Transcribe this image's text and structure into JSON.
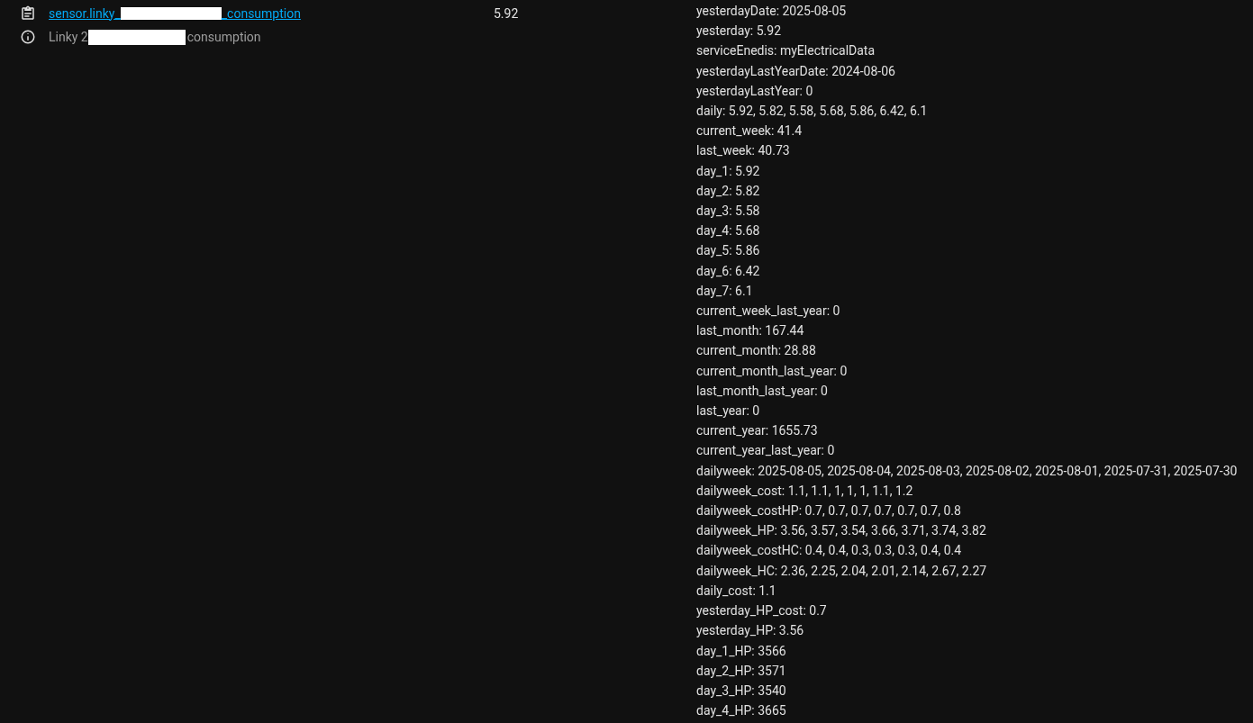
{
  "entity": {
    "entity_id_start": "sensor.linky_",
    "entity_id_end": "_consumption",
    "name_start": "Linky 2",
    "name_end": "consumption",
    "state": "5.92"
  },
  "attributes": [
    "yesterdayDate: 2025-08-05",
    "yesterday: 5.92",
    "serviceEnedis: myElectricalData",
    "yesterdayLastYearDate: 2024-08-06",
    "yesterdayLastYear: 0",
    "daily: 5.92, 5.82, 5.58, 5.68, 5.86, 6.42, 6.1",
    "current_week: 41.4",
    "last_week: 40.73",
    "day_1: 5.92",
    "day_2: 5.82",
    "day_3: 5.58",
    "day_4: 5.68",
    "day_5: 5.86",
    "day_6: 6.42",
    "day_7: 6.1",
    "current_week_last_year: 0",
    "last_month: 167.44",
    "current_month: 28.88",
    "current_month_last_year: 0",
    "last_month_last_year: 0",
    "last_year: 0",
    "current_year: 1655.73",
    "current_year_last_year: 0",
    "dailyweek: 2025-08-05, 2025-08-04, 2025-08-03, 2025-08-02, 2025-08-01, 2025-07-31, 2025-07-30",
    "dailyweek_cost: 1.1, 1.1, 1, 1, 1, 1.1, 1.2",
    "dailyweek_costHP: 0.7, 0.7, 0.7, 0.7, 0.7, 0.7, 0.8",
    "dailyweek_HP: 3.56, 3.57, 3.54, 3.66, 3.71, 3.74, 3.82",
    "dailyweek_costHC: 0.4, 0.4, 0.3, 0.3, 0.3, 0.4, 0.4",
    "dailyweek_HC: 2.36, 2.25, 2.04, 2.01, 2.14, 2.67, 2.27",
    "daily_cost: 1.1",
    "yesterday_HP_cost: 0.7",
    "yesterday_HP: 3.56",
    "day_1_HP: 3566",
    "day_2_HP: 3571",
    "day_3_HP: 3540",
    "day_4_HP: 3665"
  ]
}
